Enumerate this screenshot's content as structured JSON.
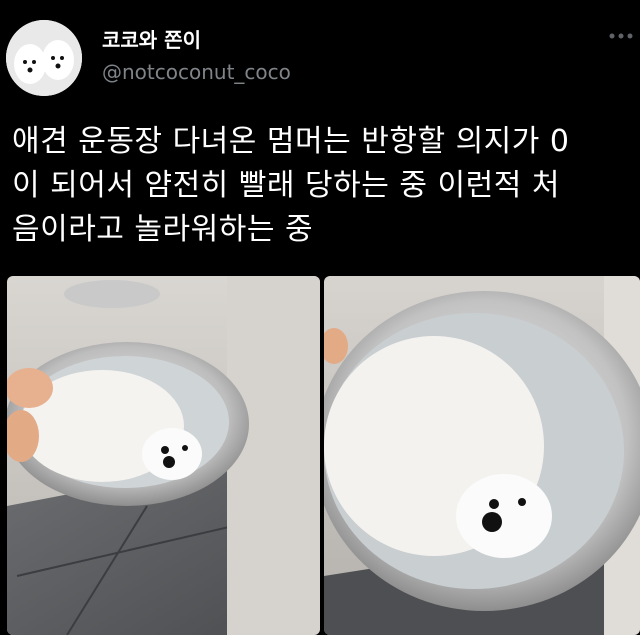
{
  "tweet": {
    "author": {
      "display_name": "코코와 쫀이",
      "handle": "@notcoconut_coco",
      "avatar": "avatar-two-white-dogs-icon"
    },
    "more_icon": "more-dots-icon",
    "text_lines": [
      "애견 운동장 다녀온 멈머는 반항할 의지가 0",
      "이 되어서 얌전히 빨래 당하는 중 이런적 처",
      "음이라고 놀라워하는 중"
    ],
    "media": [
      {
        "icon": "photo-dog-bath-left"
      },
      {
        "icon": "photo-dog-bath-right"
      }
    ]
  },
  "colors": {
    "background": "#000000",
    "text": "#ffffff",
    "secondary_text": "#7f8489"
  }
}
